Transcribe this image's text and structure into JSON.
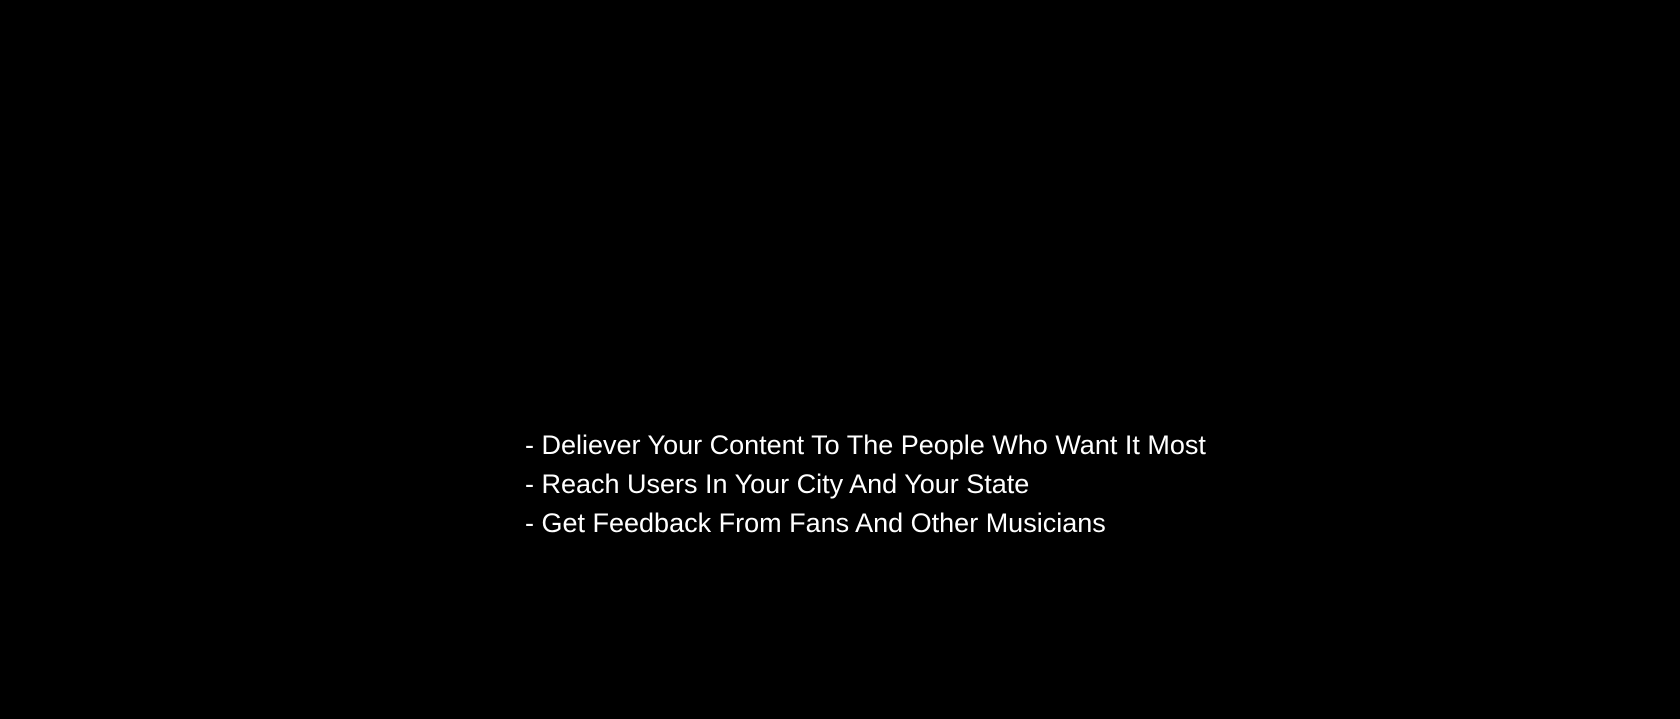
{
  "slide": {
    "background_color": "#000000",
    "text_color": "#ffffff",
    "features": [
      "- Deliever Your Content To The People Who Want It Most",
      "- Reach Users In Your City And Your State",
      "- Get Feedback From Fans And Other Musicians"
    ]
  }
}
